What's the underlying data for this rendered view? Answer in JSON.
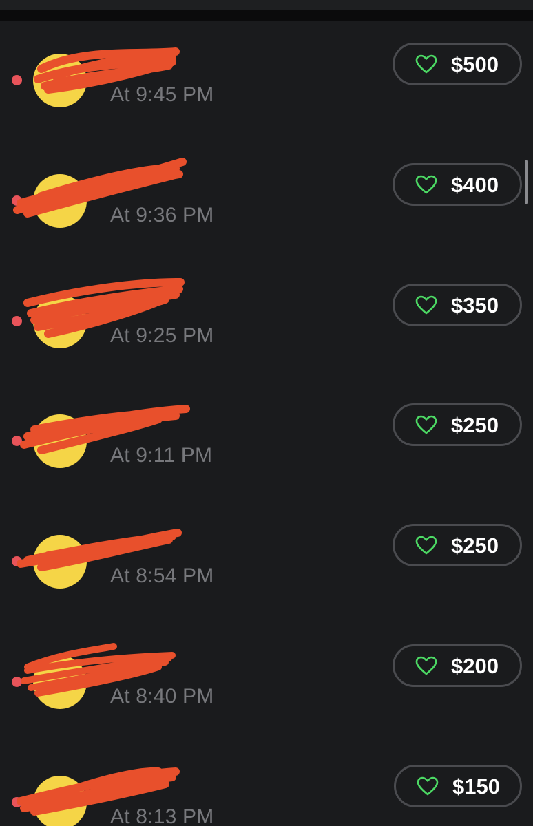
{
  "feed": {
    "items": [
      {
        "time": "At 9:45 PM",
        "amount": "$500",
        "unread": true
      },
      {
        "time": "At 9:36 PM",
        "amount": "$400",
        "unread": true
      },
      {
        "time": "At 9:25 PM",
        "amount": "$350",
        "unread": true
      },
      {
        "time": "At 9:11 PM",
        "amount": "$250",
        "unread": true
      },
      {
        "time": "At 8:54 PM",
        "amount": "$250",
        "unread": true
      },
      {
        "time": "At 8:40 PM",
        "amount": "$200",
        "unread": true
      },
      {
        "time": "At 8:13 PM",
        "amount": "$150",
        "unread": true
      }
    ]
  },
  "colors": {
    "background": "#1a1b1d",
    "avatar": "#f5d547",
    "unread_dot": "#e8545a",
    "redaction": "#e8502c",
    "heart": "#4cd964",
    "button_border": "#4a4b4f",
    "time_text": "#77787c"
  },
  "icons": {
    "tip_button": "heart-outline-icon"
  }
}
